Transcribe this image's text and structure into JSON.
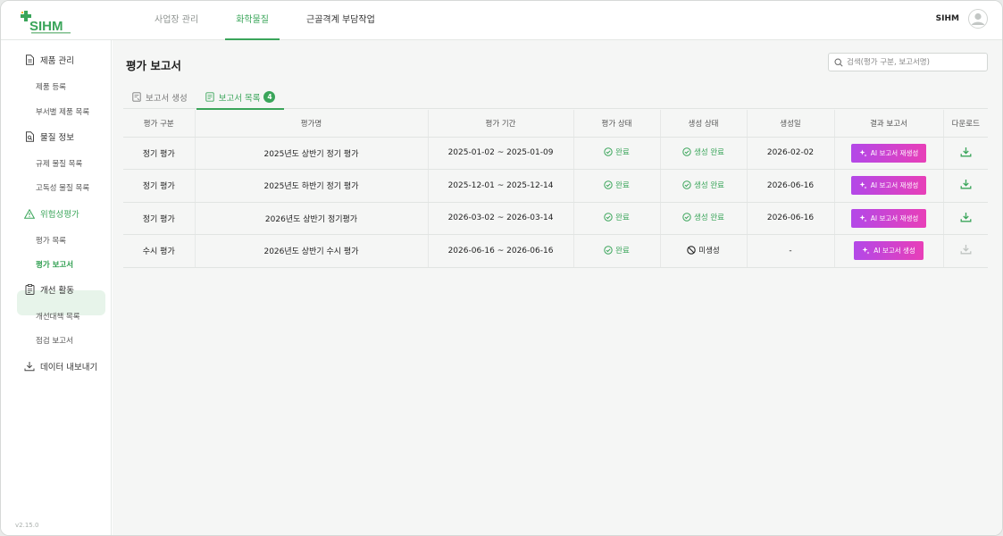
{
  "app": {
    "logo_text": "SIHM",
    "brand_color": "#3aa55a",
    "accent_gradient": [
      "#b348e8",
      "#e83fb8"
    ],
    "version": "v2.15.0"
  },
  "nav": {
    "items": [
      {
        "label": "사업장 관리"
      },
      {
        "label": "화학물질"
      },
      {
        "label": "근골격계 부담작업"
      }
    ],
    "active": "화학물질"
  },
  "user": {
    "name": "SIHM"
  },
  "sidebar": {
    "sections": [
      {
        "label": "제품 관리",
        "icon": "document-icon",
        "items": [
          "제품 등록",
          "부서별 제품 목록"
        ]
      },
      {
        "label": "물질 정보",
        "icon": "file-search-icon",
        "items": [
          "규제 물질 목록",
          "고독성 물질 목록"
        ]
      },
      {
        "label": "위험성평가",
        "icon": "warning-icon",
        "items": [
          "평가 목록",
          "평가 보고서"
        ]
      },
      {
        "label": "개선 활동",
        "icon": "clipboard-icon",
        "items": [
          "개선대책 목록",
          "점검 보고서"
        ]
      },
      {
        "label": "데이터 내보내기",
        "icon": "download-icon",
        "items": []
      }
    ],
    "active_item": "평가 보고서"
  },
  "page": {
    "title": "평가 보고서",
    "search_placeholder": "검색(평가 구분, 보고서명)",
    "tabs": [
      {
        "label": "보고서 생성",
        "icon": "report-create-icon"
      },
      {
        "label": "보고서 목록",
        "icon": "report-list-icon",
        "count": "4"
      }
    ],
    "active_tab": "보고서 목록"
  },
  "table": {
    "headers": [
      "평가 구분",
      "평가명",
      "평가 기간",
      "평가 상태",
      "생성 상태",
      "생성일",
      "결과 보고서",
      "다운로드"
    ],
    "rows": [
      {
        "type": "정기 평가",
        "name": "2025년도 상반기 정기 평가",
        "period": "2025-01-02 ~ 2025-01-09",
        "eval_status": "완료",
        "gen_status": "생성 완료",
        "created": "2026-02-02",
        "report_btn": "AI 보고서 재생성",
        "download_enabled": true
      },
      {
        "type": "정기 평가",
        "name": "2025년도 하반기 정기 평가",
        "period": "2025-12-01 ~ 2025-12-14",
        "eval_status": "완료",
        "gen_status": "생성 완료",
        "created": "2026-06-16",
        "report_btn": "AI 보고서 재생성",
        "download_enabled": true
      },
      {
        "type": "정기 평가",
        "name": "2026년도 상반기 정기평가",
        "period": "2026-03-02 ~ 2026-03-14",
        "eval_status": "완료",
        "gen_status": "생성 완료",
        "created": "2026-06-16",
        "report_btn": "AI 보고서 재생성",
        "download_enabled": true
      },
      {
        "type": "수시 평가",
        "name": "2026년도 상반기 수시 평가",
        "period": "2026-06-16 ~ 2026-06-16",
        "eval_status": "완료",
        "gen_status": "미생성",
        "created": "-",
        "report_btn": "AI 보고서 생성",
        "download_enabled": false
      }
    ]
  }
}
